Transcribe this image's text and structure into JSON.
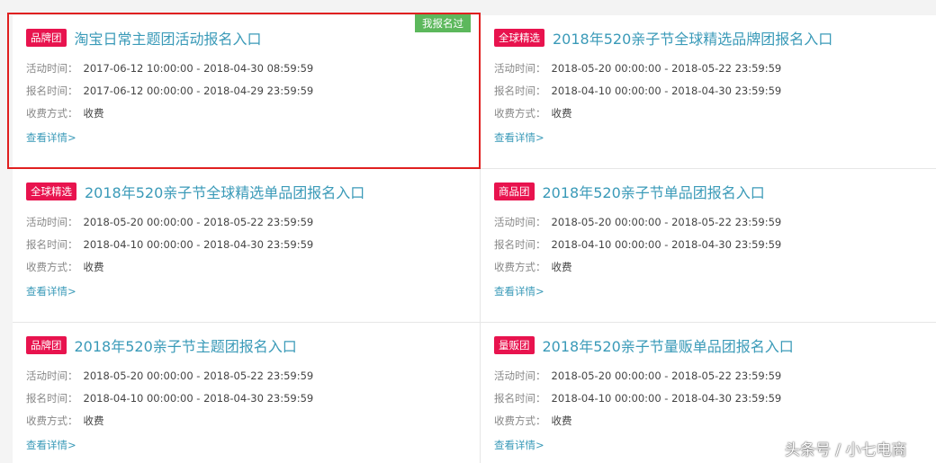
{
  "highlight_badge": "我报名过",
  "watermark": "头条号 / 小七电商",
  "labels": {
    "activity_time": "活动时间：",
    "signup_time": "报名时间：",
    "fee_type": "收费方式：",
    "view_detail": "查看详情>"
  },
  "cards": [
    {
      "tag": "品牌团",
      "title": "淘宝日常主题团活动报名入口",
      "activity_time": "2017-06-12 10:00:00 - 2018-04-30 08:59:59",
      "signup_time": "2017-06-12 00:00:00 - 2018-04-29 23:59:59",
      "fee": "收费"
    },
    {
      "tag": "全球精选",
      "title": "2018年520亲子节全球精选品牌团报名入口",
      "activity_time": "2018-05-20 00:00:00 - 2018-05-22 23:59:59",
      "signup_time": "2018-04-10 00:00:00 - 2018-04-30 23:59:59",
      "fee": "收费"
    },
    {
      "tag": "全球精选",
      "title": "2018年520亲子节全球精选单品团报名入口",
      "activity_time": "2018-05-20 00:00:00 - 2018-05-22 23:59:59",
      "signup_time": "2018-04-10 00:00:00 - 2018-04-30 23:59:59",
      "fee": "收费"
    },
    {
      "tag": "商品团",
      "title": "2018年520亲子节单品团报名入口",
      "activity_time": "2018-05-20 00:00:00 - 2018-05-22 23:59:59",
      "signup_time": "2018-04-10 00:00:00 - 2018-04-30 23:59:59",
      "fee": "收费"
    },
    {
      "tag": "品牌团",
      "title": "2018年520亲子节主题团报名入口",
      "activity_time": "2018-05-20 00:00:00 - 2018-05-22 23:59:59",
      "signup_time": "2018-04-10 00:00:00 - 2018-04-30 23:59:59",
      "fee": "收费"
    },
    {
      "tag": "量贩团",
      "title": "2018年520亲子节量贩单品团报名入口",
      "activity_time": "2018-05-20 00:00:00 - 2018-05-22 23:59:59",
      "signup_time": "2018-04-10 00:00:00 - 2018-04-30 23:59:59",
      "fee": "收费"
    }
  ]
}
